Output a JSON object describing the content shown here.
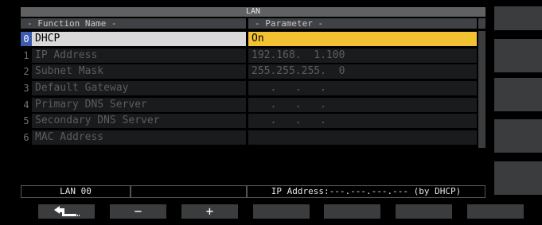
{
  "panel": {
    "title": "LAN",
    "col_name": "- Function Name -",
    "col_param": "- Parameter -"
  },
  "rows": [
    {
      "num": "0",
      "name": "DHCP",
      "param": "On"
    },
    {
      "num": "1",
      "name": "IP Address",
      "param": "192.168.  1.100"
    },
    {
      "num": "2",
      "name": "Subnet Mask",
      "param": "255.255.255.  0"
    },
    {
      "num": "3",
      "name": "Default Gateway",
      "param": "   .   .   ."
    },
    {
      "num": "4",
      "name": "Primary DNS Server",
      "param": "   .   .   ."
    },
    {
      "num": "5",
      "name": "Secondary DNS Server",
      "param": "   .   .   ."
    },
    {
      "num": "6",
      "name": "MAC Address",
      "param": ""
    }
  ],
  "status": {
    "left": "LAN 00",
    "middle": "",
    "right": "IP Address:---.---.---.--- (by DHCP)"
  },
  "softkeys": {
    "back_icon": "return-arrow-icon",
    "minus": "−",
    "plus": "+"
  },
  "colors": {
    "selected_name_bg": "#d9d9d9",
    "selected_param_bg": "#f2c233",
    "selected_num_bg": "#3b5cb0",
    "disabled_text": "#5a5c5e"
  }
}
